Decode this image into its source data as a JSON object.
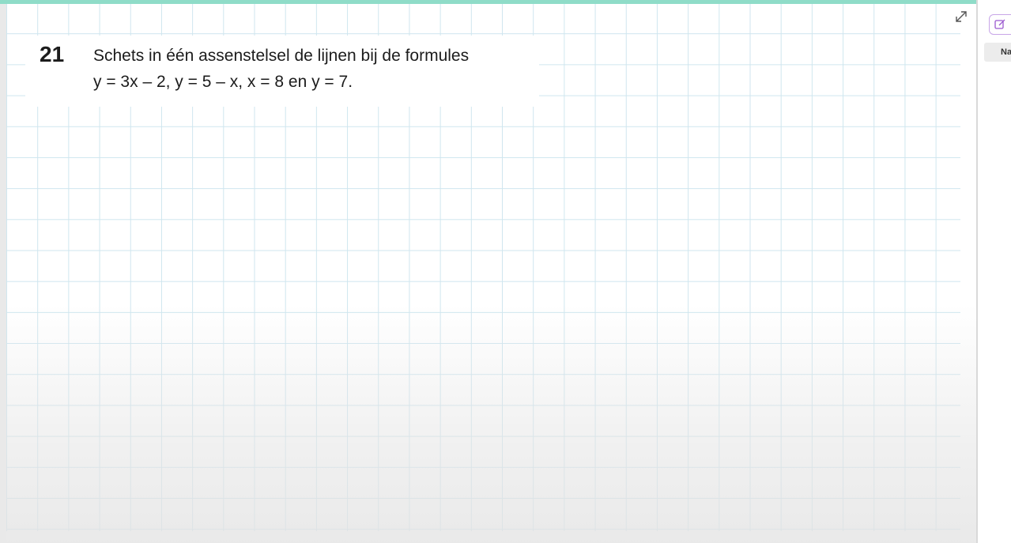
{
  "question": {
    "number": "21",
    "line1": "Schets in één assenstelsel de lijnen bij de formules",
    "line2": "y = 3x – 2, y = 5 – x, x = 8 en y = 7."
  },
  "sidebar": {
    "tab_label": "Na"
  },
  "icons": {
    "expand": "expand-icon",
    "edit": "edit-icon"
  },
  "colors": {
    "accent": "#8fdcc8",
    "grid_line": "#cfe6ef",
    "edit_border": "#c8a6e8"
  }
}
